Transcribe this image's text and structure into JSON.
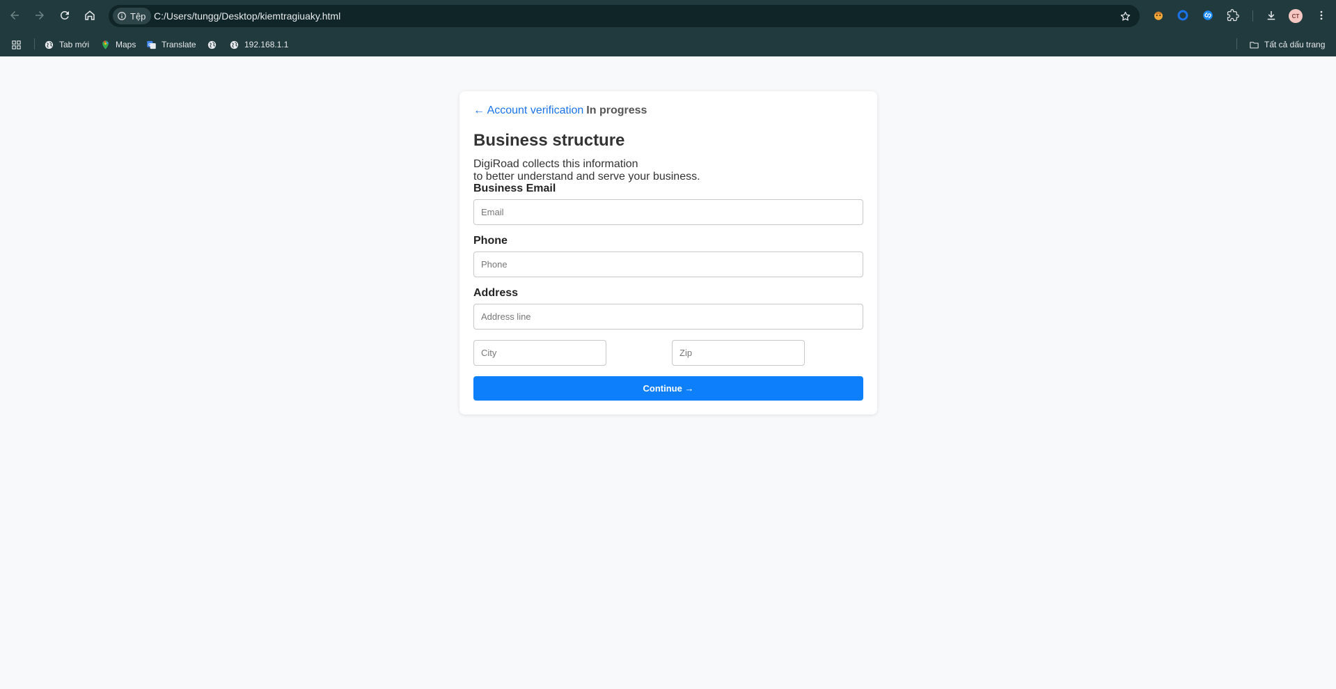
{
  "browser": {
    "site_chip_label": "Tệp",
    "url": "C:/Users/tungg/Desktop/kiemtragiuaky.html",
    "avatar_initials": "CT",
    "bookmarks": [
      {
        "label": "Tab mới",
        "icon": "globe-icon"
      },
      {
        "label": "Maps",
        "icon": "maps-icon"
      },
      {
        "label": "Translate",
        "icon": "translate-icon"
      },
      {
        "label": "",
        "icon": "globe-icon"
      },
      {
        "label": "192.168.1.1",
        "icon": "globe-icon"
      }
    ],
    "all_bookmarks_label": "Tất cả dấu trang",
    "colors": {
      "chrome_bg": "#213a3d",
      "omnibox_bg": "#0f2528",
      "text": "#e8eaed"
    }
  },
  "page": {
    "breadcrumb_link": "← Account verification",
    "breadcrumb_status": "In progress",
    "title": "Business structure",
    "description_line1": "DigiRoad collects this information",
    "description_line2": "to better understand and serve your business.",
    "email_label": "Business Email",
    "email_placeholder": "Email",
    "phone_label": "Phone",
    "phone_placeholder": "Phone",
    "address_label": "Address",
    "address_placeholder": "Address line",
    "city_placeholder": "City",
    "zip_placeholder": "Zip",
    "continue_label": "Continue →",
    "colors": {
      "accent": "#0d7ffb",
      "link": "#1a73e8",
      "background": "#f8f9fa"
    }
  }
}
